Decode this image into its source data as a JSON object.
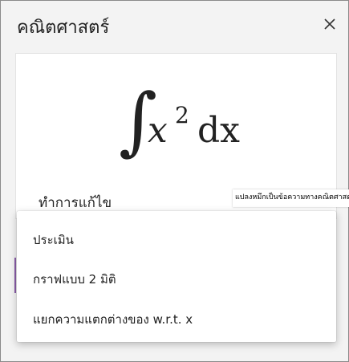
{
  "pane": {
    "title": "คณิตศาสตร์",
    "close_icon": "close-icon"
  },
  "equation": {
    "integral_sign": "∫",
    "variable": "x",
    "exponent": "2",
    "differential": "dx"
  },
  "editor": {
    "edit_label": "ทำการแก้ไข",
    "convert_label": "แปลงหมึกเป็นข้อความทางคณิตศาสตร์"
  },
  "menu": {
    "items": [
      {
        "label": "ประเมิน"
      },
      {
        "label": "กราฟแบบ 2 มิติ"
      },
      {
        "label": "แยกความแตกต่างของ w.r.t. x"
      }
    ]
  },
  "colors": {
    "accent": "#8a5ea8",
    "pane_bg": "#f3f3f3"
  }
}
